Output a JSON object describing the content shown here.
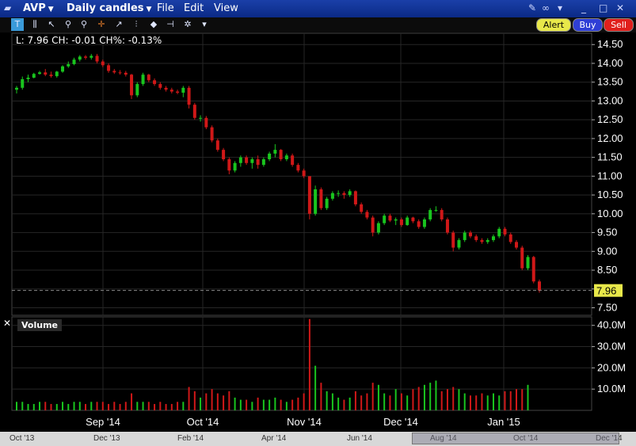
{
  "window": {
    "symbol": "AVP",
    "chart_type": "Daily candles",
    "menus": [
      "File",
      "Edit",
      "View"
    ]
  },
  "toolbar": {
    "buttons": {
      "alert": "Alert",
      "buy": "Buy",
      "sell": "Sell"
    },
    "colors": {
      "alert": "#e8e84a",
      "buy": "#2f3fd6",
      "sell": "#e0201c"
    }
  },
  "info_bar": "L: 7.96 CH: -0.01 CH%: -0.13%",
  "chart_data": {
    "type": "candlestick",
    "x_months": [
      "Sep '14",
      "Oct '14",
      "Nov '14",
      "Dec '14",
      "Jan '15"
    ],
    "price_axis": {
      "ticks": [
        "14.50",
        "14.00",
        "13.50",
        "13.00",
        "12.50",
        "12.00",
        "11.50",
        "11.00",
        "10.50",
        "10.00",
        "9.50",
        "9.00",
        "8.50",
        "8.00",
        "7.50"
      ],
      "ylim": [
        7.3,
        14.8
      ]
    },
    "last_price": {
      "label": "7.96",
      "value": 7.96
    },
    "volume_axis": {
      "ticks": [
        "40.0M",
        "30.0M",
        "20.0M",
        "10.0M"
      ],
      "ylim": [
        0,
        44
      ]
    },
    "volume_label": "Volume",
    "colors": {
      "up": "#19c51e",
      "down": "#d01818",
      "background": "#000000",
      "grid": "#262626"
    },
    "candles": [
      {
        "o": 13.3,
        "h": 13.4,
        "l": 13.2,
        "c": 13.35
      },
      {
        "o": 13.35,
        "h": 13.65,
        "l": 13.3,
        "c": 13.58
      },
      {
        "o": 13.58,
        "h": 13.7,
        "l": 13.5,
        "c": 13.62
      },
      {
        "o": 13.62,
        "h": 13.75,
        "l": 13.6,
        "c": 13.72
      },
      {
        "o": 13.72,
        "h": 13.8,
        "l": 13.7,
        "c": 13.76
      },
      {
        "o": 13.76,
        "h": 13.85,
        "l": 13.66,
        "c": 13.7
      },
      {
        "o": 13.7,
        "h": 13.78,
        "l": 13.62,
        "c": 13.66
      },
      {
        "o": 13.66,
        "h": 13.8,
        "l": 13.62,
        "c": 13.78
      },
      {
        "o": 13.78,
        "h": 13.95,
        "l": 13.75,
        "c": 13.92
      },
      {
        "o": 13.92,
        "h": 14.05,
        "l": 13.88,
        "c": 13.98
      },
      {
        "o": 13.98,
        "h": 14.15,
        "l": 13.95,
        "c": 14.1
      },
      {
        "o": 14.1,
        "h": 14.22,
        "l": 14.05,
        "c": 14.18
      },
      {
        "o": 14.18,
        "h": 14.22,
        "l": 14.1,
        "c": 14.15
      },
      {
        "o": 14.15,
        "h": 14.25,
        "l": 14.1,
        "c": 14.2
      },
      {
        "o": 14.2,
        "h": 14.25,
        "l": 14.0,
        "c": 14.05
      },
      {
        "o": 14.05,
        "h": 14.1,
        "l": 13.9,
        "c": 13.95
      },
      {
        "o": 13.95,
        "h": 14.0,
        "l": 13.75,
        "c": 13.8
      },
      {
        "o": 13.8,
        "h": 13.85,
        "l": 13.72,
        "c": 13.76
      },
      {
        "o": 13.76,
        "h": 13.82,
        "l": 13.7,
        "c": 13.75
      },
      {
        "o": 13.75,
        "h": 13.8,
        "l": 13.65,
        "c": 13.7
      },
      {
        "o": 13.7,
        "h": 13.72,
        "l": 13.05,
        "c": 13.15
      },
      {
        "o": 13.15,
        "h": 13.5,
        "l": 13.1,
        "c": 13.45
      },
      {
        "o": 13.45,
        "h": 13.75,
        "l": 13.4,
        "c": 13.7
      },
      {
        "o": 13.7,
        "h": 13.72,
        "l": 13.5,
        "c": 13.55
      },
      {
        "o": 13.55,
        "h": 13.6,
        "l": 13.4,
        "c": 13.45
      },
      {
        "o": 13.45,
        "h": 13.5,
        "l": 13.3,
        "c": 13.35
      },
      {
        "o": 13.35,
        "h": 13.4,
        "l": 13.25,
        "c": 13.3
      },
      {
        "o": 13.3,
        "h": 13.35,
        "l": 13.2,
        "c": 13.25
      },
      {
        "o": 13.25,
        "h": 13.3,
        "l": 13.18,
        "c": 13.22
      },
      {
        "o": 13.22,
        "h": 13.4,
        "l": 13.1,
        "c": 13.35
      },
      {
        "o": 13.35,
        "h": 13.4,
        "l": 12.8,
        "c": 12.9
      },
      {
        "o": 12.9,
        "h": 12.95,
        "l": 12.5,
        "c": 12.55
      },
      {
        "o": 12.55,
        "h": 12.62,
        "l": 12.45,
        "c": 12.55
      },
      {
        "o": 12.55,
        "h": 12.6,
        "l": 12.25,
        "c": 12.3
      },
      {
        "o": 12.3,
        "h": 12.35,
        "l": 11.9,
        "c": 11.95
      },
      {
        "o": 11.95,
        "h": 12.0,
        "l": 11.65,
        "c": 11.7
      },
      {
        "o": 11.7,
        "h": 11.75,
        "l": 11.4,
        "c": 11.45
      },
      {
        "o": 11.45,
        "h": 11.5,
        "l": 11.05,
        "c": 11.15
      },
      {
        "o": 11.15,
        "h": 11.4,
        "l": 11.1,
        "c": 11.35
      },
      {
        "o": 11.35,
        "h": 11.55,
        "l": 11.25,
        "c": 11.5
      },
      {
        "o": 11.5,
        "h": 11.55,
        "l": 11.3,
        "c": 11.35
      },
      {
        "o": 11.35,
        "h": 11.5,
        "l": 11.2,
        "c": 11.45
      },
      {
        "o": 11.45,
        "h": 11.55,
        "l": 11.2,
        "c": 11.3
      },
      {
        "o": 11.3,
        "h": 11.5,
        "l": 11.25,
        "c": 11.45
      },
      {
        "o": 11.45,
        "h": 11.65,
        "l": 11.4,
        "c": 11.6
      },
      {
        "o": 11.6,
        "h": 11.85,
        "l": 11.5,
        "c": 11.7
      },
      {
        "o": 11.7,
        "h": 11.72,
        "l": 11.4,
        "c": 11.45
      },
      {
        "o": 11.45,
        "h": 11.6,
        "l": 11.4,
        "c": 11.55
      },
      {
        "o": 11.55,
        "h": 11.6,
        "l": 11.25,
        "c": 11.3
      },
      {
        "o": 11.3,
        "h": 11.35,
        "l": 11.1,
        "c": 11.15
      },
      {
        "o": 11.15,
        "h": 11.2,
        "l": 10.95,
        "c": 11.0
      },
      {
        "o": 11.0,
        "h": 11.0,
        "l": 9.85,
        "c": 10.0
      },
      {
        "o": 10.0,
        "h": 10.75,
        "l": 9.95,
        "c": 10.65
      },
      {
        "o": 10.65,
        "h": 10.7,
        "l": 10.1,
        "c": 10.15
      },
      {
        "o": 10.15,
        "h": 10.45,
        "l": 10.1,
        "c": 10.4
      },
      {
        "o": 10.4,
        "h": 10.6,
        "l": 10.35,
        "c": 10.55
      },
      {
        "o": 10.55,
        "h": 10.62,
        "l": 10.45,
        "c": 10.55
      },
      {
        "o": 10.55,
        "h": 10.6,
        "l": 10.4,
        "c": 10.5
      },
      {
        "o": 10.5,
        "h": 10.65,
        "l": 10.45,
        "c": 10.6
      },
      {
        "o": 10.6,
        "h": 10.62,
        "l": 10.2,
        "c": 10.25
      },
      {
        "o": 10.25,
        "h": 10.3,
        "l": 10.0,
        "c": 10.05
      },
      {
        "o": 10.05,
        "h": 10.1,
        "l": 9.85,
        "c": 9.9
      },
      {
        "o": 9.9,
        "h": 9.95,
        "l": 9.4,
        "c": 9.5
      },
      {
        "o": 9.5,
        "h": 9.8,
        "l": 9.45,
        "c": 9.75
      },
      {
        "o": 9.75,
        "h": 10.0,
        "l": 9.7,
        "c": 9.95
      },
      {
        "o": 9.95,
        "h": 10.0,
        "l": 9.78,
        "c": 9.82
      },
      {
        "o": 9.82,
        "h": 9.9,
        "l": 9.7,
        "c": 9.85
      },
      {
        "o": 9.85,
        "h": 9.9,
        "l": 9.65,
        "c": 9.7
      },
      {
        "o": 9.7,
        "h": 9.95,
        "l": 9.68,
        "c": 9.9
      },
      {
        "o": 9.9,
        "h": 9.92,
        "l": 9.75,
        "c": 9.8
      },
      {
        "o": 9.8,
        "h": 9.85,
        "l": 9.6,
        "c": 9.65
      },
      {
        "o": 9.65,
        "h": 9.9,
        "l": 9.6,
        "c": 9.85
      },
      {
        "o": 9.85,
        "h": 10.15,
        "l": 9.8,
        "c": 10.1
      },
      {
        "o": 10.1,
        "h": 10.2,
        "l": 10.05,
        "c": 10.1
      },
      {
        "o": 10.1,
        "h": 10.15,
        "l": 9.8,
        "c": 9.85
      },
      {
        "o": 9.85,
        "h": 9.9,
        "l": 9.45,
        "c": 9.5
      },
      {
        "o": 9.5,
        "h": 9.55,
        "l": 9.0,
        "c": 9.1
      },
      {
        "o": 9.1,
        "h": 9.35,
        "l": 9.05,
        "c": 9.3
      },
      {
        "o": 9.3,
        "h": 9.55,
        "l": 9.25,
        "c": 9.5
      },
      {
        "o": 9.5,
        "h": 9.55,
        "l": 9.35,
        "c": 9.4
      },
      {
        "o": 9.4,
        "h": 9.45,
        "l": 9.25,
        "c": 9.3
      },
      {
        "o": 9.3,
        "h": 9.35,
        "l": 9.2,
        "c": 9.25
      },
      {
        "o": 9.25,
        "h": 9.35,
        "l": 9.2,
        "c": 9.3
      },
      {
        "o": 9.3,
        "h": 9.45,
        "l": 9.25,
        "c": 9.4
      },
      {
        "o": 9.4,
        "h": 9.65,
        "l": 9.35,
        "c": 9.6
      },
      {
        "o": 9.6,
        "h": 9.65,
        "l": 9.4,
        "c": 9.45
      },
      {
        "o": 9.45,
        "h": 9.5,
        "l": 9.2,
        "c": 9.25
      },
      {
        "o": 9.25,
        "h": 9.3,
        "l": 9.05,
        "c": 9.1
      },
      {
        "o": 9.1,
        "h": 9.15,
        "l": 8.5,
        "c": 8.55
      },
      {
        "o": 8.55,
        "h": 8.9,
        "l": 8.5,
        "c": 8.85
      },
      {
        "o": 8.85,
        "h": 8.88,
        "l": 8.15,
        "c": 8.2
      },
      {
        "o": 8.2,
        "h": 8.25,
        "l": 7.9,
        "c": 7.96
      }
    ],
    "volumes": [
      4,
      4,
      3,
      3,
      4,
      4,
      3,
      3,
      4,
      3,
      4,
      4,
      3,
      4,
      4,
      4,
      3,
      4,
      3,
      4,
      8,
      4,
      4,
      4,
      3,
      4,
      3,
      3,
      4,
      4,
      11,
      9,
      6,
      8,
      10,
      8,
      7,
      9,
      6,
      5,
      5,
      4,
      6,
      5,
      5,
      6,
      5,
      4,
      5,
      6,
      8,
      43,
      21,
      13,
      9,
      8,
      6,
      5,
      6,
      9,
      7,
      8,
      13,
      12,
      8,
      7,
      10,
      8,
      7,
      10,
      11,
      12,
      13,
      14,
      9,
      10,
      11,
      10,
      8,
      7,
      7,
      8,
      7,
      8,
      7,
      9,
      9,
      10,
      10,
      12
    ]
  },
  "bottom_scroll": {
    "labels": [
      "Oct '13",
      "Dec '13",
      "Feb '14",
      "Apr '14",
      "Jun '14",
      "Aug '14",
      "Oct '14",
      "Dec '14"
    ]
  }
}
